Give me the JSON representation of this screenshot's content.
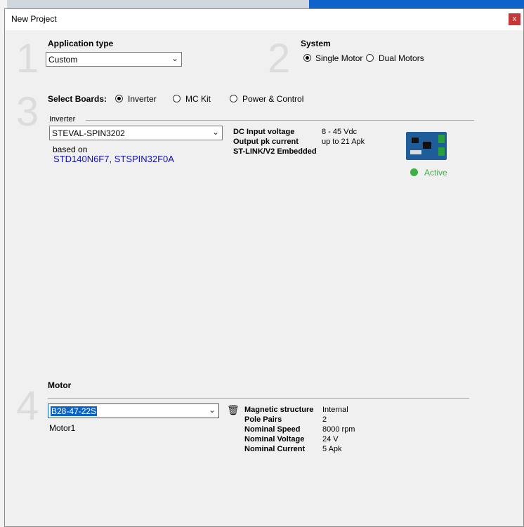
{
  "window": {
    "title": "New Project",
    "close_label": "x"
  },
  "section1": {
    "number": "1",
    "label": "Application type",
    "selected": "Custom"
  },
  "section2": {
    "number": "2",
    "label": "System",
    "options": [
      "Single Motor",
      "Dual Motors"
    ],
    "selected_index": 0
  },
  "section3": {
    "number": "3",
    "label": "Select Boards:",
    "options": [
      "Inverter",
      "MC Kit",
      "Power & Control"
    ],
    "selected_index": 0,
    "group_title": "Inverter",
    "board": "STEVAL-SPIN3202",
    "based_on_label": "based on",
    "based_on_link": "STD140N6F7, STSPIN32F0A",
    "specs": [
      {
        "key": "DC Input voltage",
        "value": "8 - 45 Vdc"
      },
      {
        "key": "Output pk current",
        "value": "up to 21 Apk"
      },
      {
        "key": "ST-LINK/V2 Embedded",
        "value": ""
      }
    ],
    "status": "Active",
    "status_color": "#3cb043"
  },
  "section4": {
    "number": "4",
    "label": "Motor",
    "motor": "B28-47-22S",
    "motor_name": "Motor1",
    "specs": [
      {
        "key": "Magnetic structure",
        "value": "Internal"
      },
      {
        "key": "Pole Pairs",
        "value": "2"
      },
      {
        "key": "Nominal Speed",
        "value": "8000 rpm"
      },
      {
        "key": "Nominal Voltage",
        "value": "24 V"
      },
      {
        "key": "Nominal Current",
        "value": "5 Apk"
      }
    ]
  },
  "icons": {
    "chevron": "chevron-down-icon",
    "trash": "trash-icon",
    "board": "board-image"
  }
}
